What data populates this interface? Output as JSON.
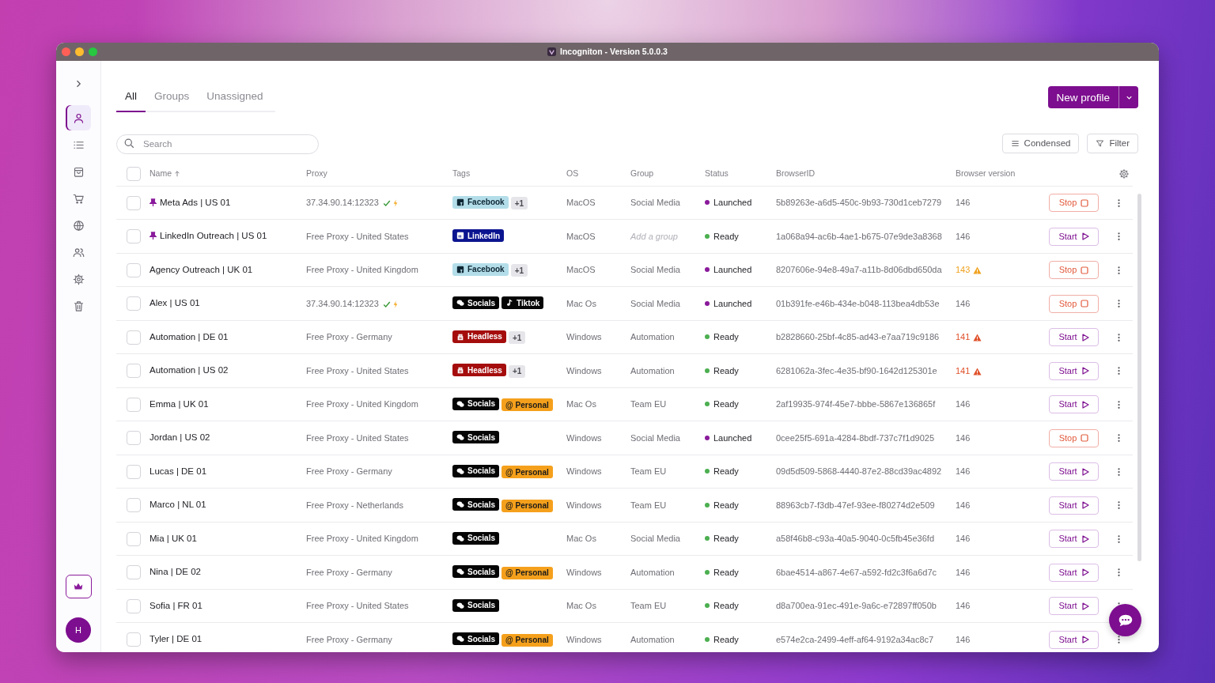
{
  "window": {
    "title": "Incogniton - Version 5.0.0.3"
  },
  "sidebar": {
    "items": [
      {
        "kind": "person",
        "selected": true
      },
      {
        "kind": "list",
        "selected": false
      },
      {
        "kind": "bag",
        "selected": false
      },
      {
        "kind": "cart",
        "selected": false
      },
      {
        "kind": "globe",
        "selected": false
      },
      {
        "kind": "people",
        "selected": false
      },
      {
        "kind": "gear",
        "selected": false
      },
      {
        "kind": "trash",
        "selected": false
      }
    ],
    "avatar": "H"
  },
  "tabs": [
    {
      "label": "All",
      "selected": true
    },
    {
      "label": "Groups",
      "selected": false
    },
    {
      "label": "Unassigned",
      "selected": false
    }
  ],
  "new_profile": {
    "label": "New profile"
  },
  "search": {
    "placeholder": "Search"
  },
  "toolbar": [
    {
      "label": "Condensed",
      "kind": "condensed"
    },
    {
      "label": "Filter",
      "kind": "filter"
    }
  ],
  "table": {
    "select_all": {
      "checked": false
    },
    "columns": [
      {
        "label": "Name",
        "sorted": true
      },
      {
        "label": "Proxy",
        "sorted": false
      },
      {
        "label": "Tags",
        "sorted": false
      },
      {
        "label": "OS",
        "sorted": false
      },
      {
        "label": "Group",
        "sorted": false
      },
      {
        "label": "Status",
        "sorted": false
      },
      {
        "label": "BrowserID",
        "sorted": false
      },
      {
        "label": "Browser version",
        "sorted": false
      }
    ],
    "rows": [
      {
        "checked": false,
        "pinned": true,
        "name": "Meta Ads | US 01",
        "proxy": "37.34.90.14:12323",
        "proxy_verified": true,
        "tags": [
          {
            "label": "Facebook",
            "kind": "facebook",
            "color": "#b3dde9"
          },
          {
            "label": "+1",
            "kind": "more",
            "color": "#e6e6ea"
          }
        ],
        "os": "MacOS",
        "group": "Social Media",
        "group_empty": false,
        "status": {
          "label": "Launched",
          "color": "#8a1a9b"
        },
        "browser_id": "5b89263e-a6d5-450c-9b93-730d1ceb7279",
        "version": "146",
        "action": {
          "label": "Stop",
          "kind": "stop"
        }
      },
      {
        "checked": false,
        "pinned": true,
        "name": "LinkedIn Outreach | US 01",
        "proxy": "Free Proxy - United States",
        "proxy_verified": false,
        "tags": [
          {
            "label": "LinkedIn",
            "kind": "linkedin",
            "color": "#0c1590"
          }
        ],
        "os": "MacOS",
        "group": "Add a group",
        "group_empty": true,
        "status": {
          "label": "Ready",
          "color": "#4caf50"
        },
        "browser_id": "1a068a94-ac6b-4ae1-b675-07e9de3a8368",
        "version": "146",
        "action": {
          "label": "Start",
          "kind": "start"
        }
      },
      {
        "checked": false,
        "pinned": false,
        "name": "Agency Outreach | UK 01",
        "proxy": "Free Proxy - United Kingdom",
        "proxy_verified": false,
        "tags": [
          {
            "label": "Facebook",
            "kind": "facebook",
            "color": "#b3dde9"
          },
          {
            "label": "+1",
            "kind": "more",
            "color": "#e6e6ea"
          }
        ],
        "os": "MacOS",
        "group": "Social Media",
        "group_empty": false,
        "status": {
          "label": "Launched",
          "color": "#8a1a9b"
        },
        "browser_id": "8207606e-94e8-49a7-a11b-8d06dbd650da",
        "version": "143",
        "version_warning": {
          "color": "#f0a21e"
        },
        "action": {
          "label": "Stop",
          "kind": "stop"
        }
      },
      {
        "checked": false,
        "pinned": false,
        "name": "Alex | US 01",
        "proxy": "37.34.90.14:12323",
        "proxy_verified": true,
        "tags": [
          {
            "label": "Socials",
            "kind": "socials",
            "color": "#050505"
          },
          {
            "label": "Tiktok",
            "kind": "tiktok",
            "color": "#050505"
          }
        ],
        "os": "Mac Os",
        "group": "Social Media",
        "group_empty": false,
        "status": {
          "label": "Launched",
          "color": "#8a1a9b"
        },
        "browser_id": "01b391fe-e46b-434e-b048-113bea4db53e",
        "version": "146",
        "action": {
          "label": "Stop",
          "kind": "stop"
        }
      },
      {
        "checked": false,
        "pinned": false,
        "name": "Automation | DE 01",
        "proxy": "Free Proxy - Germany",
        "proxy_verified": false,
        "tags": [
          {
            "label": "Headless",
            "kind": "headless",
            "color": "#a50d0d"
          },
          {
            "label": "+1",
            "kind": "more",
            "color": "#e6e6ea"
          }
        ],
        "os": "Windows",
        "group": "Automation",
        "group_empty": false,
        "status": {
          "label": "Ready",
          "color": "#4caf50"
        },
        "browser_id": "b2828660-25bf-4c85-ad43-e7aa719c9186",
        "version": "141",
        "version_warning": {
          "color": "#e0502a"
        },
        "action": {
          "label": "Start",
          "kind": "start"
        }
      },
      {
        "checked": false,
        "pinned": false,
        "name": "Automation | US 02",
        "proxy": "Free Proxy - United States",
        "proxy_verified": false,
        "tags": [
          {
            "label": "Headless",
            "kind": "headless",
            "color": "#a50d0d"
          },
          {
            "label": "+1",
            "kind": "more",
            "color": "#e6e6ea"
          }
        ],
        "os": "Windows",
        "group": "Automation",
        "group_empty": false,
        "status": {
          "label": "Ready",
          "color": "#4caf50"
        },
        "browser_id": "6281062a-3fec-4e35-bf90-1642d125301e",
        "version": "141",
        "version_warning": {
          "color": "#e0502a"
        },
        "action": {
          "label": "Start",
          "kind": "start"
        }
      },
      {
        "checked": false,
        "pinned": false,
        "name": "Emma | UK 01",
        "proxy": "Free Proxy - United Kingdom",
        "proxy_verified": false,
        "tags": [
          {
            "label": "Socials",
            "kind": "socials",
            "color": "#050505"
          },
          {
            "label": "@ Personal",
            "kind": "personal",
            "color": "#f5a01c"
          }
        ],
        "os": "Mac Os",
        "group": "Team EU",
        "group_empty": false,
        "status": {
          "label": "Ready",
          "color": "#4caf50"
        },
        "browser_id": "2af19935-974f-45e7-bbbe-5867e136865f",
        "version": "146",
        "action": {
          "label": "Start",
          "kind": "start"
        }
      },
      {
        "checked": false,
        "pinned": false,
        "name": "Jordan | US 02",
        "proxy": "Free Proxy - United States",
        "proxy_verified": false,
        "tags": [
          {
            "label": "Socials",
            "kind": "socials",
            "color": "#050505"
          }
        ],
        "os": "Windows",
        "group": "Social Media",
        "group_empty": false,
        "status": {
          "label": "Launched",
          "color": "#8a1a9b"
        },
        "browser_id": "0cee25f5-691a-4284-8bdf-737c7f1d9025",
        "version": "146",
        "action": {
          "label": "Stop",
          "kind": "stop"
        }
      },
      {
        "checked": false,
        "pinned": false,
        "name": "Lucas | DE 01",
        "proxy": "Free Proxy - Germany",
        "proxy_verified": false,
        "tags": [
          {
            "label": "Socials",
            "kind": "socials",
            "color": "#050505"
          },
          {
            "label": "@ Personal",
            "kind": "personal",
            "color": "#f5a01c"
          }
        ],
        "os": "Windows",
        "group": "Team EU",
        "group_empty": false,
        "status": {
          "label": "Ready",
          "color": "#4caf50"
        },
        "browser_id": "09d5d509-5868-4440-87e2-88cd39ac4892",
        "version": "146",
        "action": {
          "label": "Start",
          "kind": "start"
        }
      },
      {
        "checked": false,
        "pinned": false,
        "name": "Marco | NL 01",
        "proxy": "Free Proxy - Netherlands",
        "proxy_verified": false,
        "tags": [
          {
            "label": "Socials",
            "kind": "socials",
            "color": "#050505"
          },
          {
            "label": "@ Personal",
            "kind": "personal",
            "color": "#f5a01c"
          }
        ],
        "os": "Windows",
        "group": "Team EU",
        "group_empty": false,
        "status": {
          "label": "Ready",
          "color": "#4caf50"
        },
        "browser_id": "88963cb7-f3db-47ef-93ee-f80274d2e509",
        "version": "146",
        "action": {
          "label": "Start",
          "kind": "start"
        }
      },
      {
        "checked": false,
        "pinned": false,
        "name": "Mia | UK 01",
        "proxy": "Free Proxy - United Kingdom",
        "proxy_verified": false,
        "tags": [
          {
            "label": "Socials",
            "kind": "socials",
            "color": "#050505"
          }
        ],
        "os": "Mac Os",
        "group": "Social Media",
        "group_empty": false,
        "status": {
          "label": "Ready",
          "color": "#4caf50"
        },
        "browser_id": "a58f46b8-c93a-40a5-9040-0c5fb45e36fd",
        "version": "146",
        "action": {
          "label": "Start",
          "kind": "start"
        }
      },
      {
        "checked": false,
        "pinned": false,
        "name": "Nina | DE 02",
        "proxy": "Free Proxy - Germany",
        "proxy_verified": false,
        "tags": [
          {
            "label": "Socials",
            "kind": "socials",
            "color": "#050505"
          },
          {
            "label": "@ Personal",
            "kind": "personal",
            "color": "#f5a01c"
          }
        ],
        "os": "Windows",
        "group": "Automation",
        "group_empty": false,
        "status": {
          "label": "Ready",
          "color": "#4caf50"
        },
        "browser_id": "6bae4514-a867-4e67-a592-fd2c3f6a6d7c",
        "version": "146",
        "action": {
          "label": "Start",
          "kind": "start"
        }
      },
      {
        "checked": false,
        "pinned": false,
        "name": "Sofia | FR 01",
        "proxy": "Free Proxy - United States",
        "proxy_verified": false,
        "tags": [
          {
            "label": "Socials",
            "kind": "socials",
            "color": "#050505"
          }
        ],
        "os": "Mac Os",
        "group": "Team EU",
        "group_empty": false,
        "status": {
          "label": "Ready",
          "color": "#4caf50"
        },
        "browser_id": "d8a700ea-91ec-491e-9a6c-e72897ff050b",
        "version": "146",
        "action": {
          "label": "Start",
          "kind": "start"
        }
      },
      {
        "checked": false,
        "pinned": false,
        "name": "Tyler | DE 01",
        "proxy": "Free Proxy - Germany",
        "proxy_verified": false,
        "tags": [
          {
            "label": "Socials",
            "kind": "socials",
            "color": "#050505"
          },
          {
            "label": "@ Personal",
            "kind": "personal",
            "color": "#f5a01c"
          }
        ],
        "os": "Windows",
        "group": "Automation",
        "group_empty": false,
        "status": {
          "label": "Ready",
          "color": "#4caf50"
        },
        "browser_id": "e574e2ca-2499-4eff-af64-9192a34ac8c7",
        "version": "146",
        "action": {
          "label": "Start",
          "kind": "start"
        }
      }
    ]
  }
}
